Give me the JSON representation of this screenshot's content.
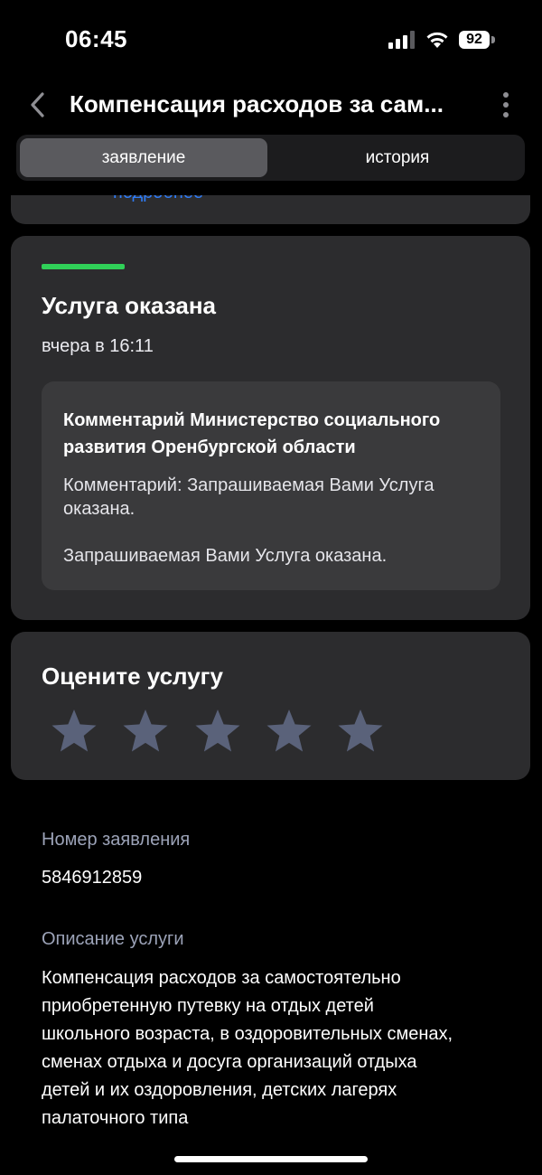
{
  "status_bar": {
    "time": "06:45",
    "battery": "92"
  },
  "nav": {
    "title": "Компенсация расходов за сам...",
    "back_icon": "chevron-left-icon",
    "menu_icon": "more-vertical-icon"
  },
  "tabs": [
    {
      "label": "заявление",
      "active": true
    },
    {
      "label": "история",
      "active": false
    }
  ],
  "partial_link": "подробнее",
  "status_card": {
    "title": "Услуга оказана",
    "time": "вчера в 16:11",
    "accent_color": "#30d158",
    "comment_title": "Комментарий Министерство социального развития Оренбургской области",
    "comment_text": "Комментарий: Запрашиваемая Вами Услуга оказана.",
    "comment_text2": "Запрашиваемая Вами Услуга оказана."
  },
  "rating": {
    "title": "Оцените услугу",
    "value": 0,
    "max": 5,
    "star_color": "#5a627a"
  },
  "details": {
    "number_label": "Номер заявления",
    "number_value": "5846912859",
    "description_label": "Описание услуги",
    "description_lines": [
      "Компенсация расходов за самостоятельно",
      "приобретенную путевку на отдых детей",
      "школьного возраста, в оздоровительных сменах,",
      "сменах отдыха и досуга организаций отдыха",
      "детей и их оздоровления, детских лагерях",
      "палаточного типа"
    ]
  }
}
